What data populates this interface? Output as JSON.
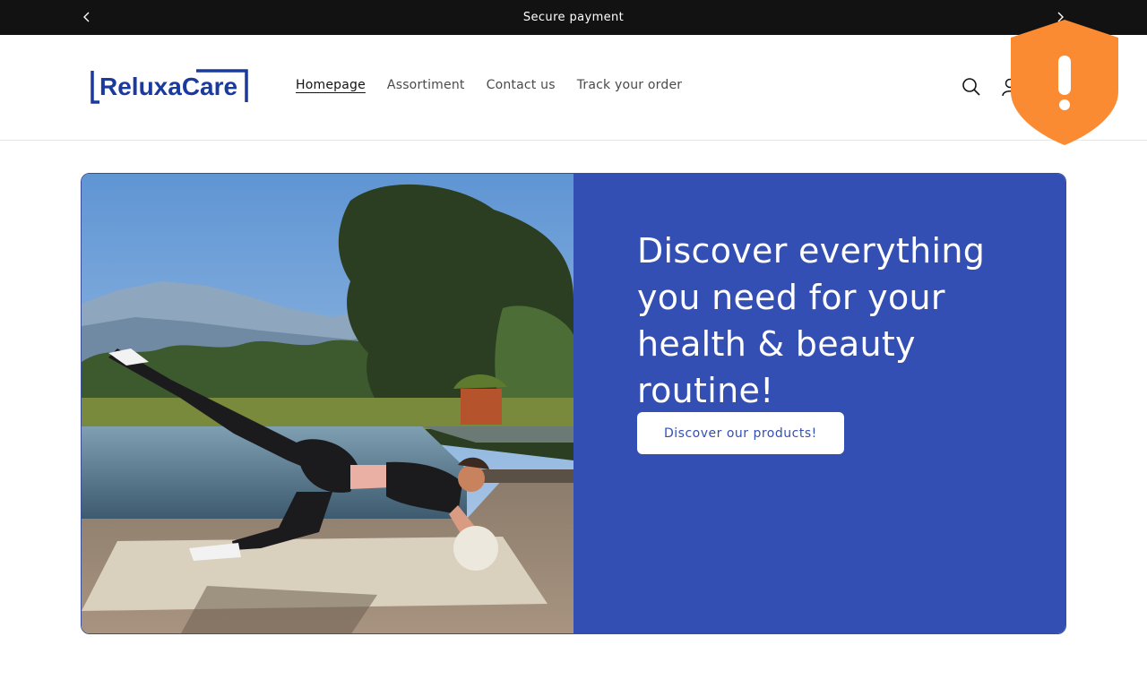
{
  "announcement": {
    "text": "Secure payment",
    "prev_icon": "chevron-left-icon",
    "next_icon": "chevron-right-icon"
  },
  "header": {
    "logo_text": "ReluxaCare",
    "nav": [
      {
        "label": "Homepage",
        "active": true
      },
      {
        "label": "Assortiment",
        "active": false
      },
      {
        "label": "Contact us",
        "active": false
      },
      {
        "label": "Track your order",
        "active": false
      }
    ],
    "icons": [
      "search-icon",
      "account-icon"
    ]
  },
  "security_badge": {
    "icon": "shield-warning-icon",
    "color": "#fb8b33"
  },
  "hero": {
    "title": "Discover everything you need for your health & beauty routine!",
    "button_label": "Discover our products!",
    "panel_color": "#334fb4",
    "image": "woman-doing-yoga-by-pool-image"
  },
  "colors": {
    "announcement_bg": "#121212",
    "brand_blue": "#1a3a9e",
    "hero_blue": "#334fb4"
  }
}
